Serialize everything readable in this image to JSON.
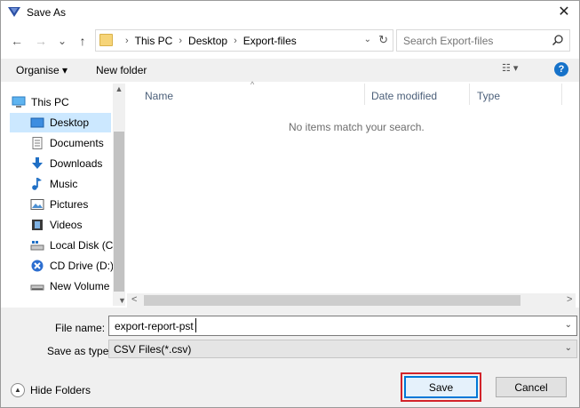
{
  "window": {
    "title": "Save As",
    "close_glyph": "✕"
  },
  "nav_buttons": {
    "back_glyph": "←",
    "forward_glyph": "→",
    "recent_glyph": "⌄",
    "up_glyph": "↑"
  },
  "address": {
    "crumbs": [
      "This PC",
      "Desktop",
      "Export-files"
    ],
    "dropdown_glyph": "⌄",
    "refresh_glyph": "↻"
  },
  "search": {
    "placeholder": "Search Export-files"
  },
  "toolbar": {
    "organise_label": "Organise ▾",
    "new_folder_label": "New folder",
    "view_glyph": "☷ ▾",
    "help_glyph": "?"
  },
  "nav_pane": {
    "items": [
      {
        "label": "This PC",
        "icon": "computer-icon"
      },
      {
        "label": "Desktop",
        "icon": "desktop-icon",
        "selected": true
      },
      {
        "label": "Documents",
        "icon": "documents-icon"
      },
      {
        "label": "Downloads",
        "icon": "downloads-icon"
      },
      {
        "label": "Music",
        "icon": "music-icon"
      },
      {
        "label": "Pictures",
        "icon": "pictures-icon"
      },
      {
        "label": "Videos",
        "icon": "videos-icon"
      },
      {
        "label": "Local Disk (C:)",
        "icon": "local-disk-icon"
      },
      {
        "label": "CD Drive (D:) X",
        "icon": "cd-drive-icon"
      },
      {
        "label": "New Volume (",
        "icon": "volume-icon"
      }
    ]
  },
  "file_list": {
    "columns": [
      "Name",
      "Date modified",
      "Type"
    ],
    "empty_message": "No items match your search."
  },
  "form": {
    "file_name_label": "File name:",
    "file_name_value": "export-report-pst",
    "save_type_label": "Save as type:",
    "save_type_value": "CSV Files(*.csv)"
  },
  "footer": {
    "hide_folders_label": "Hide Folders",
    "save_label": "Save",
    "cancel_label": "Cancel"
  },
  "colors": {
    "accent": "#0078d7",
    "highlight": "#d2232a",
    "selection": "#cce8ff"
  }
}
